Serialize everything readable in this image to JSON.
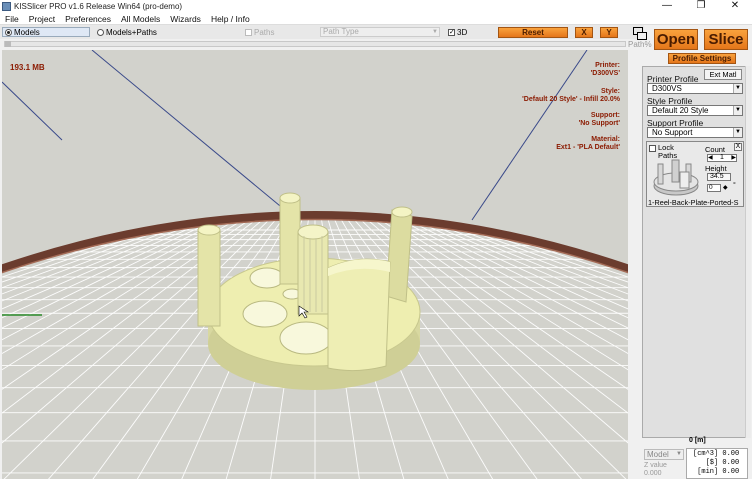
{
  "window": {
    "title": "KISSlicer PRO v1.6 Release  Win64 (pro-demo)",
    "minimize": "—",
    "restore": "❐",
    "close": "✕"
  },
  "menu": [
    "File",
    "Project",
    "Preferences",
    "All Models",
    "Wizards",
    "Help / Info"
  ],
  "toolbar": {
    "models_label": "Models",
    "models_paths_label": "Models+Paths",
    "paths_label": "Paths",
    "path_type_placeholder": "Path Type",
    "three_d_label": "3D",
    "reset_label": "Reset",
    "x_label": "X",
    "y_label": "Y",
    "path_pct_label": "Path%",
    "path_slider_value": 0
  },
  "overlay": {
    "memory": "193.1 MB",
    "printer_header": "Printer:",
    "printer_value": "'D300VS'",
    "style_header": "Style:",
    "style_value": "'Default 20 Style' - Infill 20.0%",
    "support_header": "Support:",
    "support_value": "'No Support'",
    "material_header": "Material:",
    "material_value": "Ext1 - 'PLA Default'"
  },
  "actions": {
    "open_label": "Open",
    "slice_label": "Slice",
    "profile_settings_label": "Profile Settings"
  },
  "profiles": {
    "printer_label": "Printer Profile",
    "printer_value": "D300VS",
    "ext_matl_label": "Ext Matl",
    "style_label": "Style Profile",
    "style_value": "Default 20 Style",
    "support_label": "Support Profile",
    "support_value": "No Support"
  },
  "model_card": {
    "lock_label": "Lock Paths",
    "close_label": "X",
    "count_label": "Count",
    "count_value": "1",
    "height_label": "Height",
    "height_value": "34.5",
    "rotation_value": "0",
    "degree_symbol": "°",
    "name": "1-Reel-Back-Plate-Ported-S"
  },
  "bottom": {
    "position_readout": "0 [m]",
    "model_dropdown": "Model",
    "z_value_label": "Z value",
    "z_value": "0.000",
    "stats": [
      "[cm^3] 0.00",
      "   [$] 0.00",
      " [min] 0.00"
    ]
  },
  "colors": {
    "accent_orange": "#f0902a",
    "model_yellow": "#eeeeb0",
    "overlay_text": "#8b1a00",
    "floor": "#d2d2cc",
    "rim": "#7a4a3a"
  }
}
